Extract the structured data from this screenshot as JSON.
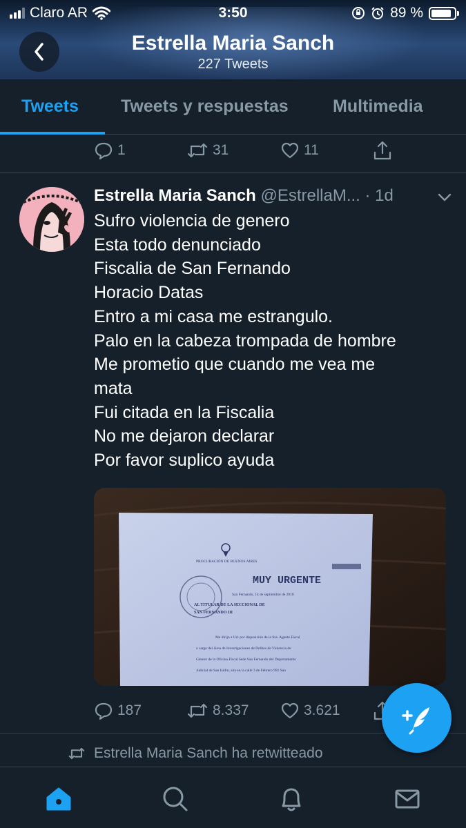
{
  "status_bar": {
    "carrier": "Claro AR",
    "time": "3:50",
    "battery_percent": "89 %",
    "battery_level": 0.89
  },
  "header": {
    "title": "Estrella Maria Sanch",
    "subtitle": "227 Tweets",
    "back_icon": "chevron-left-icon"
  },
  "tabs": [
    {
      "label": "Tweets",
      "active": true
    },
    {
      "label": "Tweets y respuestas",
      "active": false
    },
    {
      "label": "Multimedia",
      "active": false
    }
  ],
  "previous_tweet_actions": {
    "replies": "1",
    "retweets": "31",
    "likes": "11"
  },
  "tweet": {
    "name": "Estrella Maria Sanch",
    "handle": "@EstrellaM...",
    "time": "· 1d",
    "lines": [
      "Sufro violencia de genero",
      "Esta todo denunciado",
      "Fiscalia de San Fernando",
      "Horacio Datas",
      "Entro a mi casa me estrangulo.",
      "Palo en la cabeza trompada de hombre",
      "Me prometio que cuando me vea me",
      "mata",
      "Fui citada en la Fiscalia",
      "No me dejaron declarar",
      "Por favor suplico ayuda"
    ],
    "media": {
      "doc_header": "PROCURACIÓN DE BUENOS AIRES",
      "doc_urgent": "MUY URGENTE",
      "doc_date": "San Fernando, 14 de septiembre de 2018",
      "doc_to_1": "AL TITULAR DE LA SECCIONAL DE",
      "doc_to_2": "SAN FERNANDO III",
      "doc_body_1": "Me dirijo a Ud. por disposición de la Sra. Agente Fiscal",
      "doc_body_2": "a cargo del Área de Investigaciones de Delitos de Violencia de",
      "doc_body_3": "Género de la Oficina Fiscal Sede San Fernando del Departamento",
      "doc_body_4": "Judicial de San Isidro, sita en la calle 3 de Febrero 991 San"
    },
    "actions": {
      "replies": "187",
      "retweets": "8.337",
      "likes": "3.621"
    }
  },
  "retweet_notice": "Estrella Maria Sanch ha retwitteado",
  "colors": {
    "background": "#15202b",
    "accent": "#1da1f2",
    "muted": "#8899a6",
    "divider": "#38444d"
  },
  "bottom_nav": [
    "home-icon",
    "search-icon",
    "notifications-icon",
    "messages-icon"
  ]
}
